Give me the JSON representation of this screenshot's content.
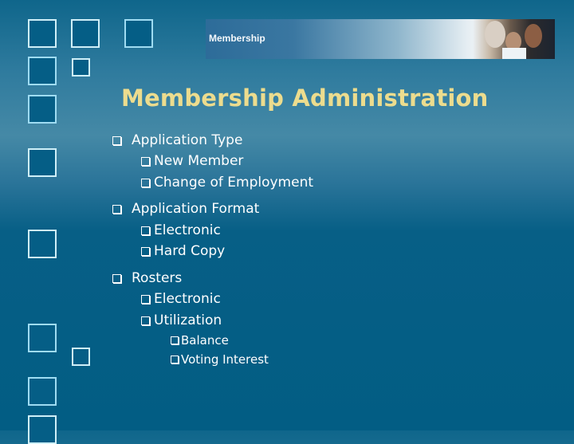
{
  "banner": {
    "label": "Membership",
    "photo": "people-photo"
  },
  "slide": {
    "title": "Membership Administration",
    "bullets": [
      {
        "label": "Application Type",
        "children": [
          {
            "label": "New Member"
          },
          {
            "label": "Change of Employment"
          }
        ]
      },
      {
        "label": "Application Format",
        "children": [
          {
            "label": "Electronic"
          },
          {
            "label": "Hard Copy"
          }
        ]
      },
      {
        "label": "Rosters",
        "children": [
          {
            "label": "Electronic"
          },
          {
            "label": "Utilization",
            "children": [
              {
                "label": "Balance"
              },
              {
                "label": "Voting Interest"
              }
            ]
          }
        ]
      }
    ]
  },
  "colors": {
    "title": "#ecdc8e",
    "text": "#ffffff",
    "background_dark": "#025d84",
    "background_light": "#4589a6"
  },
  "icons": {
    "bullet": "checkbox-square-bullet",
    "decoration": "outlined-square"
  }
}
